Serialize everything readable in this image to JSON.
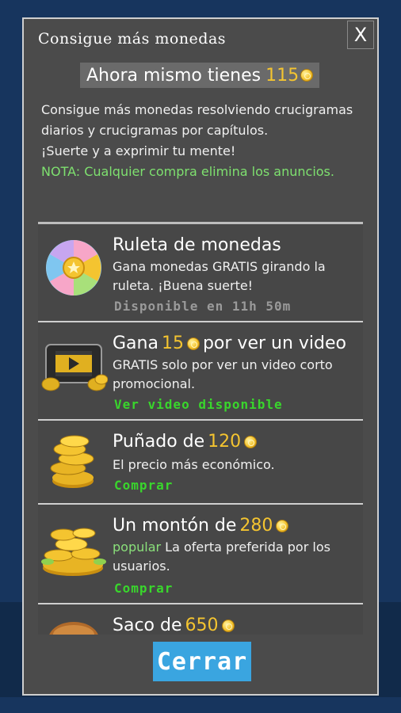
{
  "dialog": {
    "title": "Consigue más monedas",
    "close_label": "X",
    "balance_label": "Ahora mismo tienes",
    "balance_value": "115",
    "description": "Consigue más monedas resolviendo crucigramas diarios y crucigramas por capítulos.",
    "luck": "¡Suerte y a exprimir tu mente!",
    "nota": "NOTA: Cualquier compra elimina los anuncios."
  },
  "offers": [
    {
      "title": "Ruleta de monedas",
      "body": "Gana monedas GRATIS girando la ruleta. ¡Buena suerte!",
      "status": "Disponible en 11h 50m"
    },
    {
      "title_prefix": "Gana",
      "amount": "15",
      "title_suffix": "por ver un video",
      "body": "GRATIS solo por ver un video corto promocional.",
      "status": "Ver video disponible"
    },
    {
      "title_prefix": "Puñado de",
      "amount": "120",
      "body": "El precio más económico.",
      "status": "Comprar"
    },
    {
      "title_prefix": "Un montón de",
      "amount": "280",
      "tag": "popular",
      "body": "La oferta preferida por los usuarios.",
      "status": "Comprar"
    },
    {
      "title_prefix": "Saco de",
      "amount": "650"
    }
  ],
  "footer": {
    "close_button": "Cerrar"
  },
  "colors": {
    "accent_gold": "#f4c430",
    "available_green": "#39d62c",
    "button_blue": "#3aa5e0"
  }
}
